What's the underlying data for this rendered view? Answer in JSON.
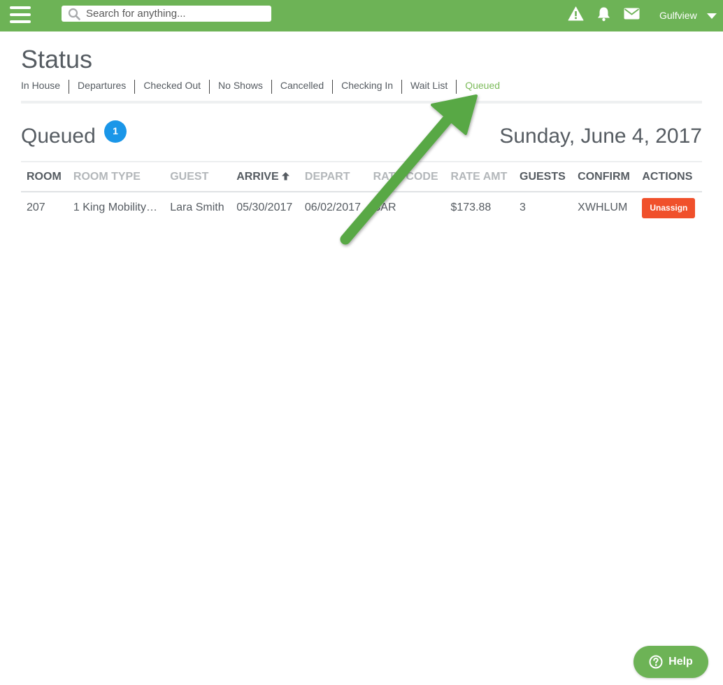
{
  "header": {
    "search_placeholder": "Search for anything...",
    "location": "Gulfview",
    "icons": [
      "menu-icon",
      "search-icon",
      "alert-icon",
      "bell-icon",
      "mail-icon",
      "caret-down-icon"
    ]
  },
  "page": {
    "title": "Status",
    "tabs": [
      {
        "label": "In House",
        "active": false
      },
      {
        "label": "Departures",
        "active": false
      },
      {
        "label": "Checked Out",
        "active": false
      },
      {
        "label": "No Shows",
        "active": false
      },
      {
        "label": "Cancelled",
        "active": false
      },
      {
        "label": "Checking In",
        "active": false
      },
      {
        "label": "Wait List",
        "active": false
      },
      {
        "label": "Queued",
        "active": true
      }
    ]
  },
  "section": {
    "title": "Queued",
    "count": "1",
    "date": "Sunday, June 4, 2017"
  },
  "table": {
    "headers": [
      "ROOM",
      "ROOM TYPE",
      "GUEST",
      "ARRIVE",
      "DEPART",
      "RATE CODE",
      "RATE AMT",
      "GUESTS",
      "CONFIRM",
      "ACTIONS"
    ],
    "sorted_by": "ARRIVE",
    "sort_direction": "ascending",
    "rows": [
      {
        "room": "207",
        "room_type": "1 King Mobility…",
        "guest": "Lara Smith",
        "arrive": "05/30/2017",
        "depart": "06/02/2017",
        "rate_code": "BAR",
        "rate_amt": "$173.88",
        "guests": "3",
        "confirm": "XWHLUM",
        "action_label": "Unassign"
      }
    ]
  },
  "help": {
    "label": "Help"
  },
  "colors": {
    "brand_green": "#6db356",
    "active_tab": "#7dbb5b",
    "badge_blue": "#1a96e8",
    "unassign_red": "#f0502b",
    "arrow_green": "#58a845"
  }
}
